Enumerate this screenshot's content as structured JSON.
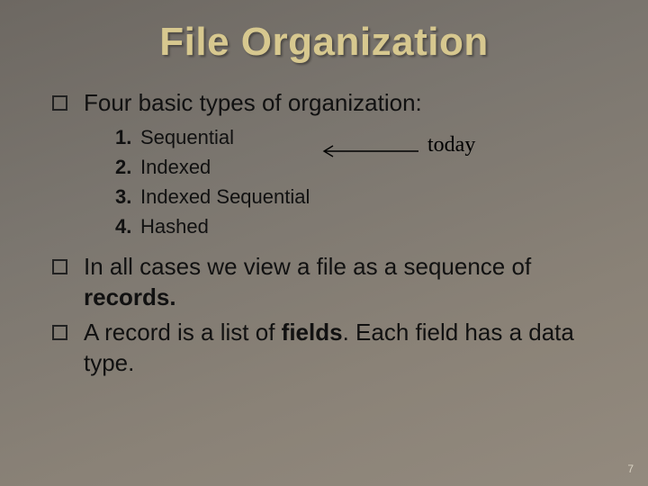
{
  "title": "File Organization",
  "bullets": [
    {
      "text_html": "Four basic types of organization:"
    },
    {
      "text_html": "In all cases we view a file as a sequence of <span class=\"bold\">records.</span>"
    },
    {
      "text_html": "A record is a list of <span class=\"bold\">fields</span>. Each field has a data type."
    }
  ],
  "numbered": [
    {
      "n": "1.",
      "label": "Sequential"
    },
    {
      "n": "2.",
      "label": "Indexed"
    },
    {
      "n": "3.",
      "label": "Indexed Sequential"
    },
    {
      "n": "4.",
      "label": "Hashed"
    }
  ],
  "annotation": {
    "today": "today"
  },
  "page_number": "7"
}
